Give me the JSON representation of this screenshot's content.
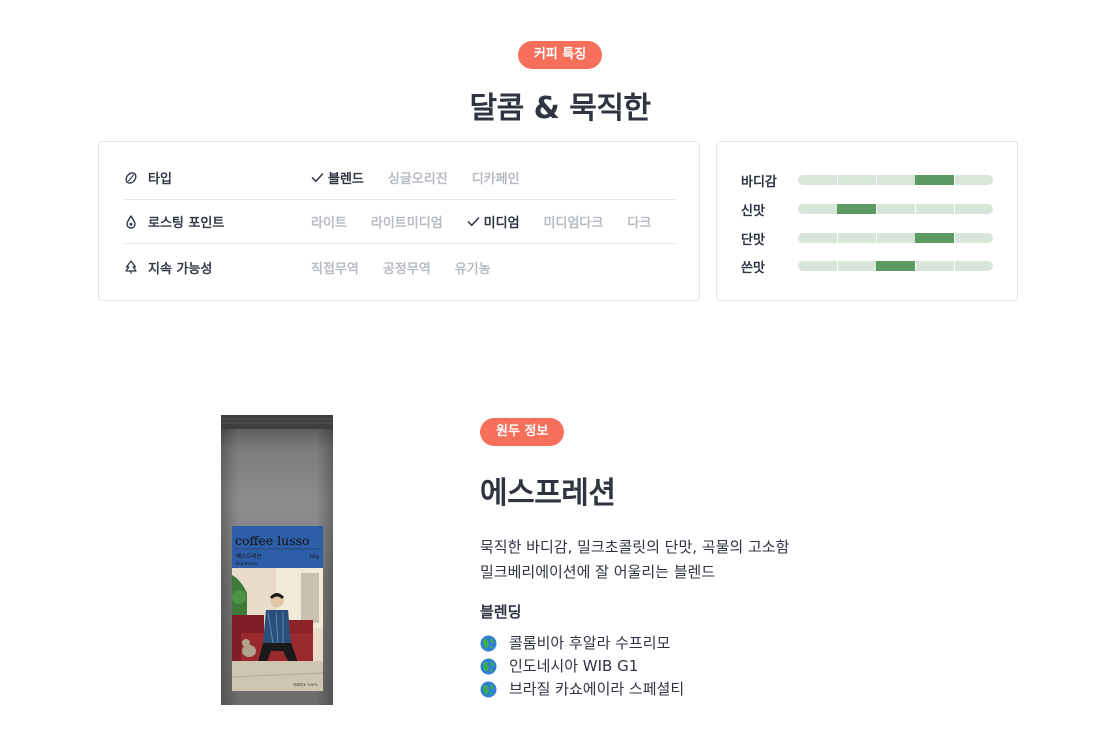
{
  "feature": {
    "badge": "커피 특징",
    "title": "달콤 & 묵직한"
  },
  "attributes": [
    {
      "label": "타입",
      "icon": "coffee-bean-icon",
      "options": [
        {
          "text": "블렌드",
          "selected": true
        },
        {
          "text": "싱글오리진",
          "selected": false
        },
        {
          "text": "디카페인",
          "selected": false
        }
      ]
    },
    {
      "label": "로스팅 포인트",
      "icon": "drop-icon",
      "options": [
        {
          "text": "라이트",
          "selected": false
        },
        {
          "text": "라이트미디엄",
          "selected": false
        },
        {
          "text": "미디엄",
          "selected": true
        },
        {
          "text": "미디엄다크",
          "selected": false
        },
        {
          "text": "다크",
          "selected": false
        }
      ]
    },
    {
      "label": "지속 가능성",
      "icon": "tree-icon",
      "options": [
        {
          "text": "직접무역",
          "selected": false
        },
        {
          "text": "공정무역",
          "selected": false
        },
        {
          "text": "유기농",
          "selected": false
        }
      ]
    }
  ],
  "taste": {
    "scale_max": 5,
    "items": [
      {
        "name": "바디감",
        "level": 4
      },
      {
        "name": "신맛",
        "level": 2
      },
      {
        "name": "단맛",
        "level": 4
      },
      {
        "name": "쓴맛",
        "level": 3
      }
    ]
  },
  "bean": {
    "badge": "원두 정보",
    "name": "에스프레션",
    "desc_line1": "묵직한 바디감, 밀크초콜릿의 단맛, 곡물의 고소함",
    "desc_line2": "밀크베리에이션에 잘 어울리는 블렌드",
    "blend_title": "블렌딩",
    "blend": [
      "콜롬비아 후알라 수프리모",
      "인도네시아 WIB G1",
      "브라질 카쇼에이라 스페셜티"
    ]
  },
  "package": {
    "brand": "coffee lusso",
    "product": "에스프레션",
    "product_en": "Espression",
    "weight": "100g",
    "footer": "카페루소 100%"
  },
  "colors": {
    "accent": "#f56f5a",
    "bar_bg": "#d6e6d8",
    "bar_fill": "#5c9a64",
    "muted": "#b7bbc2",
    "text": "#2f3440"
  }
}
